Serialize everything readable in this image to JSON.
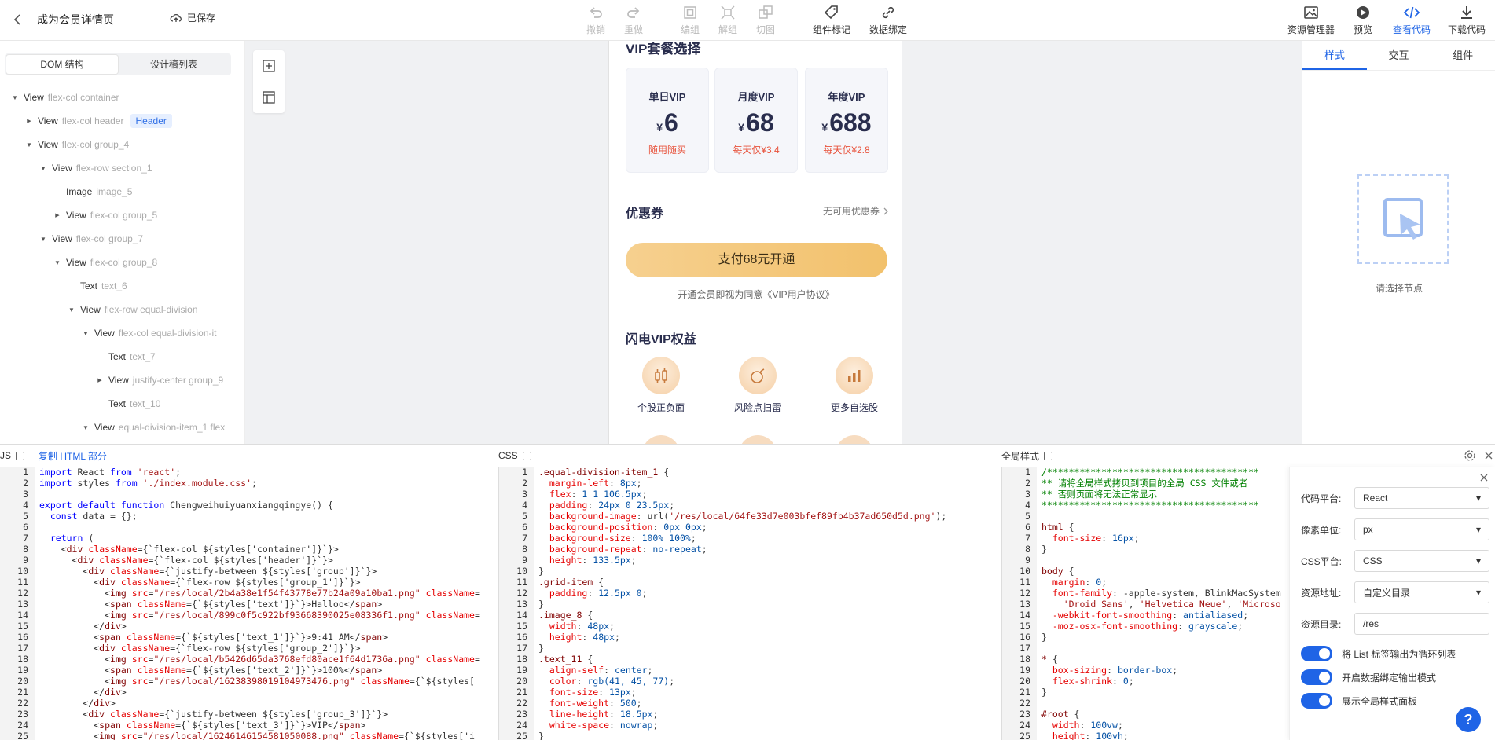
{
  "header": {
    "title": "成为会员详情页",
    "saved": "已保存",
    "tools": [
      {
        "label": "撤销",
        "icon": "undo-icon"
      },
      {
        "label": "重做",
        "icon": "redo-icon"
      },
      {
        "label": "编组",
        "icon": "group-icon"
      },
      {
        "label": "解组",
        "icon": "ungroup-icon"
      },
      {
        "label": "切图",
        "icon": "slice-icon"
      },
      {
        "label": "组件标记",
        "icon": "tag-icon"
      },
      {
        "label": "数据绑定",
        "icon": "link-icon"
      }
    ],
    "right_tools": [
      {
        "label": "资源管理器",
        "icon": "image-icon"
      },
      {
        "label": "预览",
        "icon": "play-icon"
      },
      {
        "label": "查看代码",
        "icon": "code-icon"
      },
      {
        "label": "下载代码",
        "icon": "download-icon"
      }
    ]
  },
  "left_panel": {
    "tabs": [
      "DOM 结构",
      "设计稿列表"
    ],
    "tree": [
      {
        "name": "View",
        "cls": "flex-col container"
      },
      {
        "name": "View",
        "cls": "flex-col header",
        "badge": "Header"
      },
      {
        "name": "View",
        "cls": "flex-col group_4"
      },
      {
        "name": "View",
        "cls": "flex-row section_1"
      },
      {
        "name": "Image",
        "cls": "image_5"
      },
      {
        "name": "View",
        "cls": "flex-col group_5"
      },
      {
        "name": "View",
        "cls": "flex-col group_7"
      },
      {
        "name": "View",
        "cls": "flex-col group_8"
      },
      {
        "name": "Text",
        "cls": "text_6"
      },
      {
        "name": "View",
        "cls": "flex-row equal-division"
      },
      {
        "name": "View",
        "cls": "flex-col equal-division-it"
      },
      {
        "name": "Text",
        "cls": "text_7"
      },
      {
        "name": "View",
        "cls": "justify-center group_9"
      },
      {
        "name": "Text",
        "cls": "text_10"
      },
      {
        "name": "View",
        "cls": "equal-division-item_1 flex"
      }
    ]
  },
  "phone": {
    "vip_title": "VIP套餐选择",
    "plans": [
      {
        "name": "单日VIP",
        "currency": "¥",
        "price": "6",
        "desc": "随用随买"
      },
      {
        "name": "月度VIP",
        "currency": "¥",
        "price": "68",
        "desc": "每天仅¥3.4"
      },
      {
        "name": "年度VIP",
        "currency": "¥",
        "price": "688",
        "desc": "每天仅¥2.8"
      }
    ],
    "coupon_label": "优惠券",
    "coupon_value": "无可用优惠券",
    "pay_button": "支付68元开通",
    "agreement": "开通会员即视为同意《VIP用户协议》",
    "rights_title": "闪电VIP权益",
    "rights": [
      "个股正负面",
      "风险点扫雷",
      "更多自选股"
    ]
  },
  "right_panel": {
    "tabs": [
      "样式",
      "交互",
      "组件"
    ],
    "empty_text": "请选择节点"
  },
  "bottom": {
    "js_label": "JS",
    "copy_html": "复制 HTML 部分",
    "css_label": "CSS",
    "global_label": "全局样式",
    "settings": {
      "platform_label": "代码平台:",
      "platform": "React",
      "unit_label": "像素单位:",
      "unit": "px",
      "css_label": "CSS平台:",
      "css": "CSS",
      "res_label": "资源地址:",
      "res": "自定义目录",
      "dir_label": "资源目录:",
      "dir": "/res",
      "toggle1": "将 List 标签输出为循环列表",
      "toggle2": "开启数据绑定输出模式",
      "toggle3": "展示全局样式面板",
      "help": "?"
    }
  }
}
